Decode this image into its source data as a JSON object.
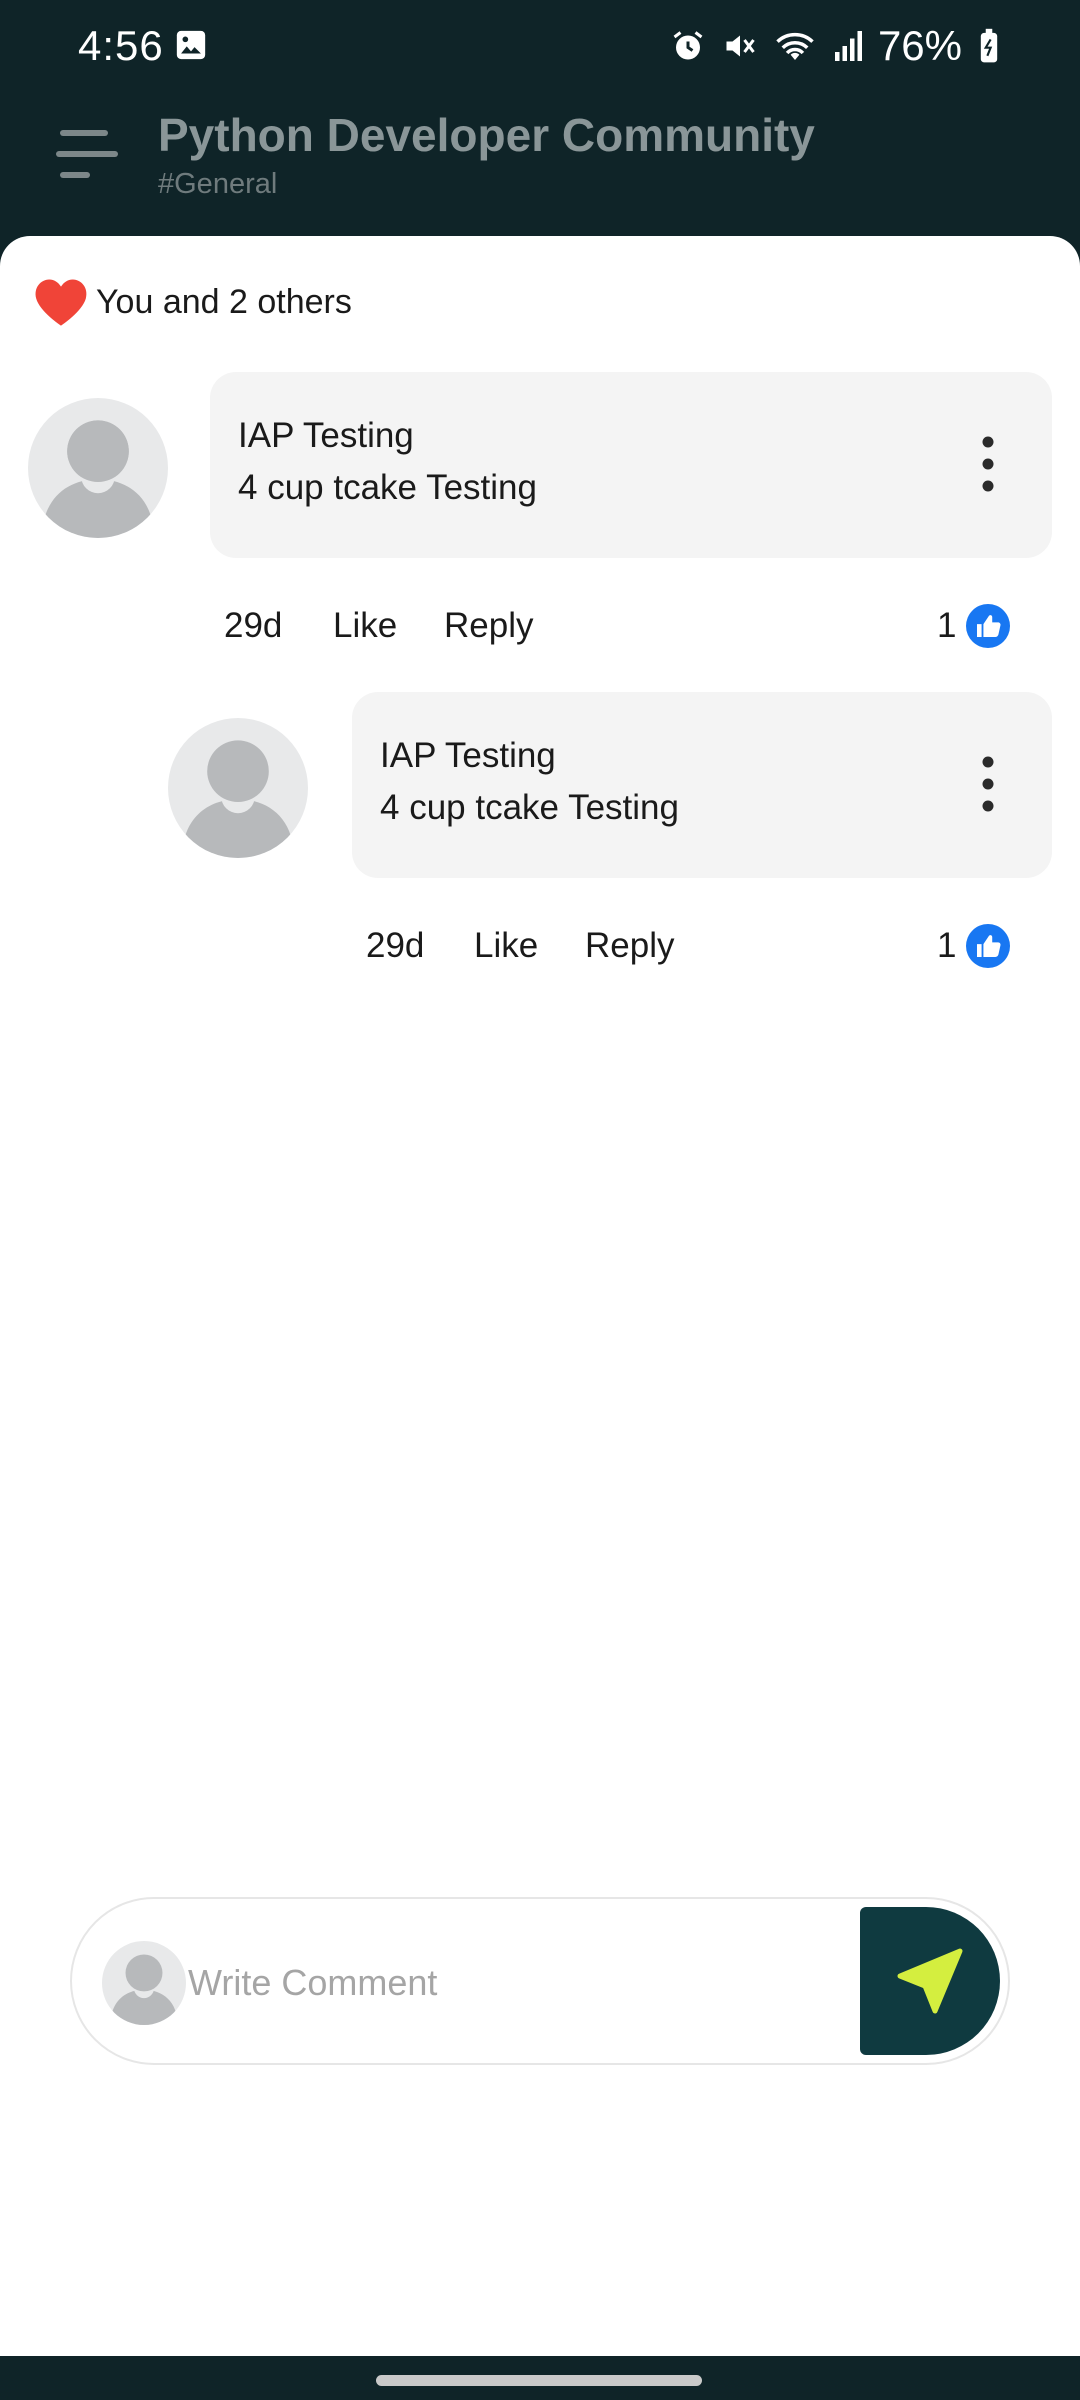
{
  "status_bar": {
    "time": "4:56",
    "battery": "76%",
    "icons": [
      "gallery-icon",
      "alarm-icon",
      "mute-icon",
      "wifi-icon",
      "signal-icon",
      "battery-icon"
    ]
  },
  "header": {
    "title": "Python Developer Community",
    "channel": "#General",
    "menu_icon": "menu-icon"
  },
  "likes_summary": {
    "text": "You and 2 others",
    "icon": "heart-icon",
    "color": "#f04438"
  },
  "comments": [
    {
      "name": "IAP Testing",
      "text": "4 cup tcake Testing",
      "age": "29d",
      "like_label": "Like",
      "reply_label": "Reply",
      "like_count": "1"
    },
    {
      "name": "IAP Testing",
      "text": "4 cup tcake Testing",
      "age": "29d",
      "like_label": "Like",
      "reply_label": "Reply",
      "like_count": "1"
    }
  ],
  "comment_input": {
    "placeholder": "Write Comment",
    "send_icon": "send-icon"
  },
  "colors": {
    "header_bg": "#0f2428",
    "send_bg": "#0f3a40",
    "send_arrow": "#d4ee3f",
    "like_blue": "#1877f2",
    "heart": "#f04438"
  }
}
